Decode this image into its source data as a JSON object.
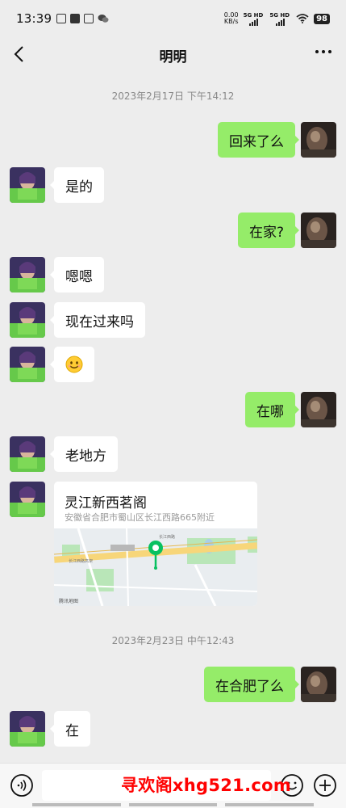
{
  "status": {
    "time": "13:39",
    "net_speed_value": "0.00",
    "net_speed_unit": "KB/s",
    "signal1": "5G HD",
    "signal2": "5G HD",
    "battery": "98"
  },
  "header": {
    "title": "明明"
  },
  "timestamps": [
    "2023年2月17日 下午14:12",
    "2023年2月23日 中午12:43"
  ],
  "messages": [
    {
      "from": "me",
      "text": "回来了么"
    },
    {
      "from": "friend",
      "text": "是的"
    },
    {
      "from": "me",
      "text": "在家?"
    },
    {
      "from": "friend",
      "text": "嗯嗯"
    },
    {
      "from": "friend",
      "text": "现在过来吗"
    },
    {
      "from": "friend",
      "emoji": "smile-icon"
    },
    {
      "from": "me",
      "text": "在哪"
    },
    {
      "from": "friend",
      "text": "老地方"
    },
    {
      "from": "me",
      "text": "在合肥了么"
    },
    {
      "from": "friend",
      "text": "在"
    }
  ],
  "location": {
    "name": "灵江新西茗阁",
    "address": "安徽省合肥市蜀山区长江西路665附近",
    "map_labels": [
      "长江西路高架",
      "长江西路",
      "腾讯地图"
    ]
  },
  "input": {
    "placeholder": ""
  },
  "watermark": "寻欢阁xhg521.com",
  "colors": {
    "background": "#ededed",
    "outgoing_bubble": "#95ec69",
    "incoming_bubble": "#ffffff",
    "watermark": "#ff0000"
  }
}
